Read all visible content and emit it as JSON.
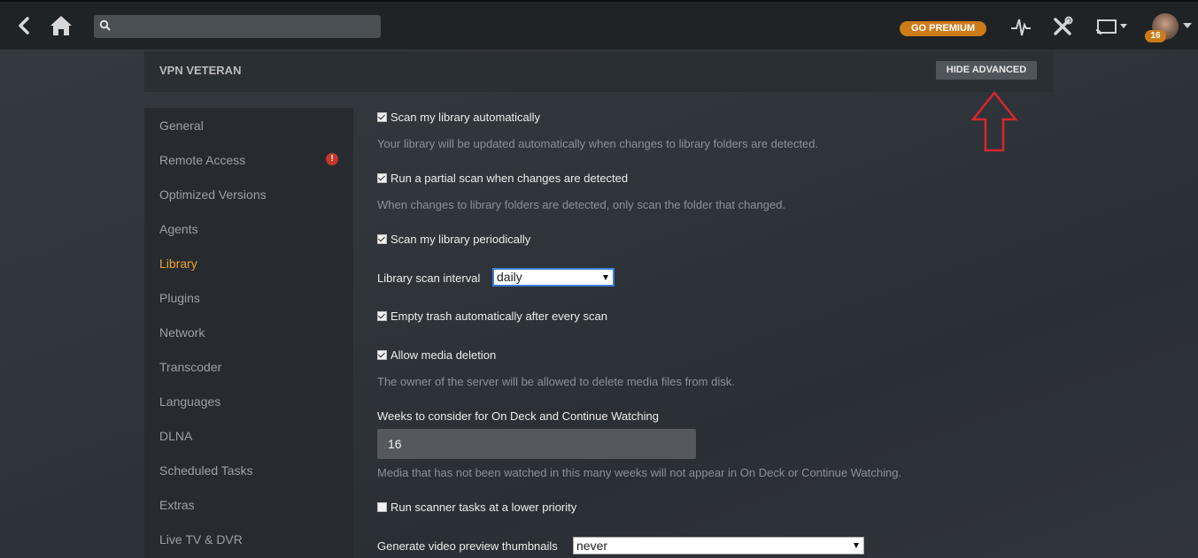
{
  "topbar": {
    "search": {
      "placeholder": "",
      "value": ""
    },
    "premium_label": "GO PREMIUM",
    "badge_count": "16",
    "icons": [
      "back-icon",
      "home-icon",
      "search-icon",
      "activity-icon",
      "tools-icon",
      "cast-icon",
      "avatar"
    ]
  },
  "server": {
    "name": "VPN VETERAN",
    "hide_advanced_label": "HIDE ADVANCED"
  },
  "sidebar": {
    "items": [
      {
        "label": "General"
      },
      {
        "label": "Remote Access",
        "alert": "!"
      },
      {
        "label": "Optimized Versions"
      },
      {
        "label": "Agents"
      },
      {
        "label": "Library",
        "active": true
      },
      {
        "label": "Plugins"
      },
      {
        "label": "Network"
      },
      {
        "label": "Transcoder"
      },
      {
        "label": "Languages"
      },
      {
        "label": "DLNA"
      },
      {
        "label": "Scheduled Tasks"
      },
      {
        "label": "Extras"
      },
      {
        "label": "Live TV & DVR"
      }
    ]
  },
  "settings": {
    "scan_auto": {
      "label": "Scan my library automatically",
      "checked": true,
      "help": "Your library will be updated automatically when changes to library folders are detected."
    },
    "partial_scan": {
      "label": "Run a partial scan when changes are detected",
      "checked": true,
      "help": "When changes to library folders are detected, only scan the folder that changed."
    },
    "scan_periodic": {
      "label": "Scan my library periodically",
      "checked": true
    },
    "scan_interval": {
      "label": "Library scan interval",
      "value": "daily"
    },
    "empty_trash": {
      "label": "Empty trash automatically after every scan",
      "checked": true
    },
    "allow_deletion": {
      "label": "Allow media deletion",
      "checked": true,
      "help": "The owner of the server will be allowed to delete media files from disk."
    },
    "weeks_on_deck": {
      "label": "Weeks to consider for On Deck and Continue Watching",
      "value": "16",
      "help": "Media that has not been watched in this many weeks will not appear in On Deck or Continue Watching."
    },
    "low_priority": {
      "label": "Run scanner tasks at a lower priority",
      "checked": false
    },
    "video_thumbnails": {
      "label": "Generate video preview thumbnails",
      "value": "never"
    }
  },
  "colors": {
    "accent": "#f0a52b",
    "premium": "#cc7b19",
    "alert": "#c0392b",
    "annotation_arrow": "#d9262c"
  }
}
